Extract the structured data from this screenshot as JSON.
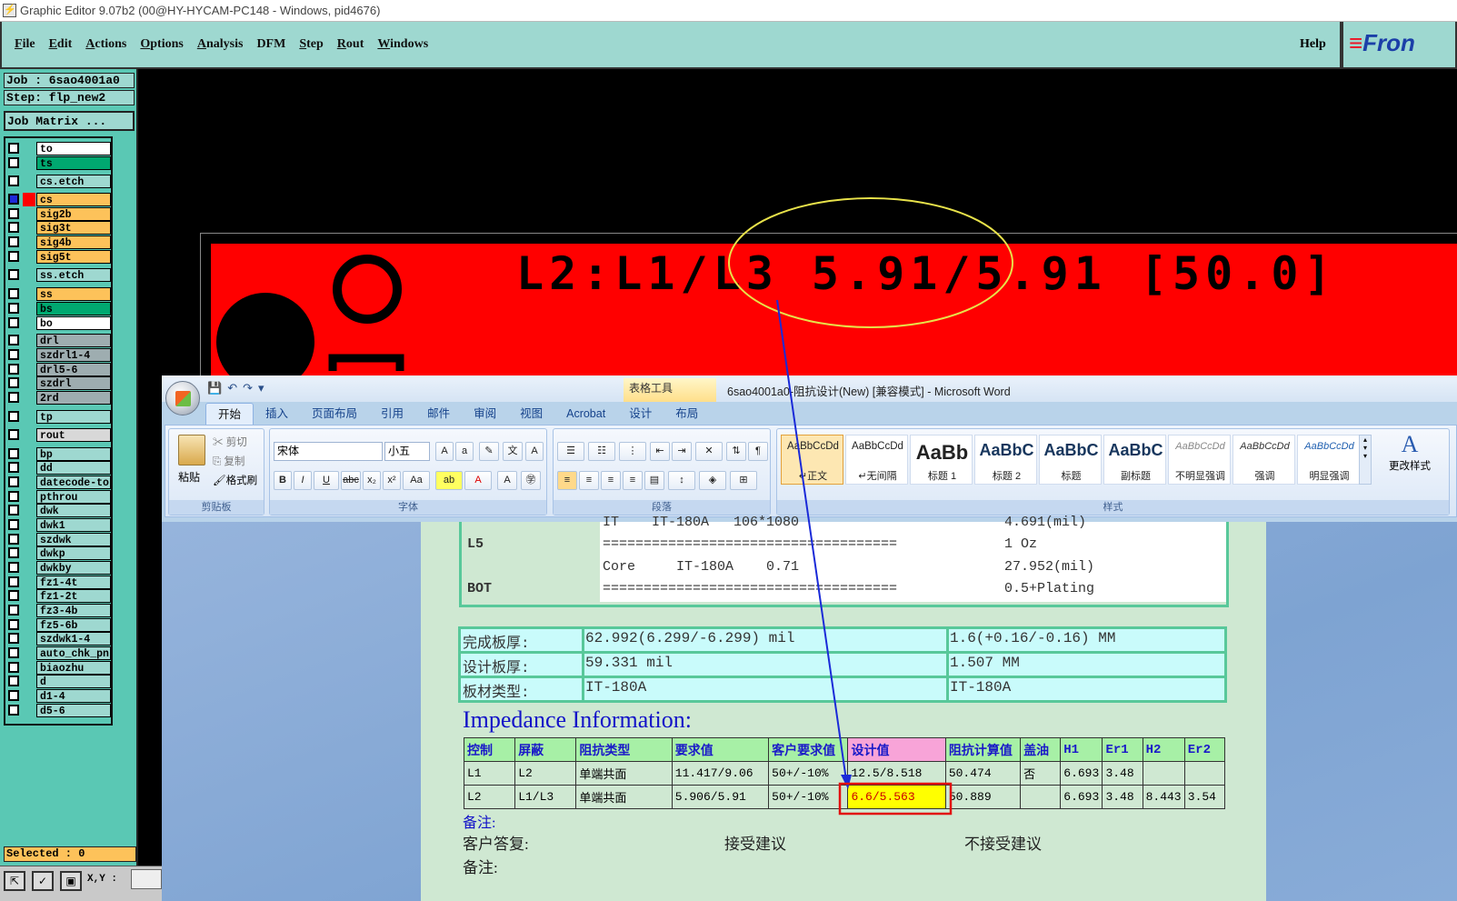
{
  "ge": {
    "title": "Graphic Editor 9.07b2 (00@HY-HYCAM-PC148 - Windows, pid4676)",
    "menu": [
      "File",
      "Edit",
      "Actions",
      "Options",
      "Analysis",
      "DFM",
      "Step",
      "Rout",
      "Windows"
    ],
    "help": "Help",
    "logo": "Fron",
    "job_label": "Job : 6sao4001a0",
    "step_label": "Step: flp_new2",
    "job_matrix": "Job Matrix ...",
    "selected": "Selected : 0",
    "coord_label": "X,Y :",
    "layers": [
      {
        "name": "to",
        "color": "#ffffff"
      },
      {
        "name": "ts",
        "color": "#00a870"
      },
      {
        "name": "cs.etch",
        "color": "#9ed8d0"
      },
      {
        "name": "cs",
        "color": "#fdc25a",
        "active": true
      },
      {
        "name": "sig2b",
        "color": "#fdc25a"
      },
      {
        "name": "sig3t",
        "color": "#fdc25a"
      },
      {
        "name": "sig4b",
        "color": "#fdc25a"
      },
      {
        "name": "sig5t",
        "color": "#fdc25a"
      },
      {
        "name": "ss.etch",
        "color": "#9ed8d0"
      },
      {
        "name": "ss",
        "color": "#fdc25a"
      },
      {
        "name": "bs",
        "color": "#00a870"
      },
      {
        "name": "bo",
        "color": "#ffffff"
      },
      {
        "name": "drl",
        "color": "#9eadb0"
      },
      {
        "name": "szdrl1-4",
        "color": "#9eadb0"
      },
      {
        "name": "drl5-6",
        "color": "#9eadb0"
      },
      {
        "name": "szdrl",
        "color": "#9eadb0"
      },
      {
        "name": "2rd",
        "color": "#9eadb0"
      },
      {
        "name": "tp",
        "color": "#9ed8d0"
      },
      {
        "name": "rout",
        "color": "#d8d8d8"
      },
      {
        "name": "bp",
        "color": "#9ed8d0"
      },
      {
        "name": "dd",
        "color": "#9ed8d0"
      },
      {
        "name": "datecode-to",
        "color": "#9ed8d0"
      },
      {
        "name": "pthrou",
        "color": "#9ed8d0"
      },
      {
        "name": "dwk",
        "color": "#9ed8d0"
      },
      {
        "name": "dwk1",
        "color": "#9ed8d0"
      },
      {
        "name": "szdwk",
        "color": "#9ed8d0"
      },
      {
        "name": "dwkp",
        "color": "#9ed8d0"
      },
      {
        "name": "dwkby",
        "color": "#9ed8d0"
      },
      {
        "name": "fz1-4t",
        "color": "#9ed8d0"
      },
      {
        "name": "fz1-2t",
        "color": "#9ed8d0"
      },
      {
        "name": "fz3-4b",
        "color": "#9ed8d0"
      },
      {
        "name": "fz5-6b",
        "color": "#9ed8d0"
      },
      {
        "name": "szdwk1-4",
        "color": "#9ed8d0"
      },
      {
        "name": "auto_chk_pn",
        "color": "#9ed8d0"
      },
      {
        "name": "biaozhu",
        "color": "#9ed8d0"
      },
      {
        "name": "d",
        "color": "#9ed8d0"
      },
      {
        "name": "d1-4",
        "color": "#9ed8d0"
      },
      {
        "name": "d5-6",
        "color": "#9ed8d0"
      }
    ],
    "board_text": "L2:L1/L3 5.91/5.91 [50.0]",
    "colors": {
      "board": "#ff0000",
      "menubar": "#9ed8d0",
      "panel": "#5ac8b4",
      "highlight_ellipse": "#e8e24a",
      "arrow": "#1a2ad8"
    }
  },
  "word": {
    "title": "6sao4001a0-阻抗设计(New) [兼容模式] - Microsoft Word",
    "table_tools": "表格工具",
    "tabs": [
      "开始",
      "插入",
      "页面布局",
      "引用",
      "邮件",
      "审阅",
      "视图",
      "Acrobat",
      "设计",
      "布局"
    ],
    "clipboard": {
      "paste": "粘贴",
      "cut": "剪切",
      "copy": "复制",
      "format_painter": "格式刷",
      "label": "剪贴板"
    },
    "font": {
      "name": "宋体",
      "size": "小五",
      "label": "字体"
    },
    "paragraph_label": "段落",
    "styles_label": "样式",
    "change_styles": "更改样式",
    "styles": [
      {
        "preview": "AaBbCcDd",
        "label": "↵正文",
        "active": true
      },
      {
        "preview": "AaBbCcDd",
        "label": "↵无间隔"
      },
      {
        "preview": "AaBb",
        "label": "标题 1"
      },
      {
        "preview": "AaBbC",
        "label": "标题 2"
      },
      {
        "preview": "AaBbC",
        "label": "标题"
      },
      {
        "preview": "AaBbC",
        "label": "副标题"
      },
      {
        "preview": "AaBbCcDd",
        "label": "不明显强调"
      },
      {
        "preview": "AaBbCcDd",
        "label": "强调"
      },
      {
        "preview": "AaBbCcDd",
        "label": "明显强调"
      }
    ]
  },
  "doc": {
    "stack_rows": [
      {
        "left": "",
        "mid": "IT    IT-180A   106*1080",
        "right": "4.691(mil)"
      },
      {
        "left": "L5",
        "mid": "====================================",
        "right": "1 Oz"
      },
      {
        "left": "",
        "mid": "Core     IT-180A    0.71",
        "right": "27.952(mil)"
      },
      {
        "left": "BOT",
        "mid": "====================================",
        "right": "0.5+Plating"
      }
    ],
    "thickness": [
      {
        "label": "完成板厚:",
        "mil": "62.992(6.299/-6.299) mil",
        "mm": "1.6(+0.16/-0.16) MM"
      },
      {
        "label": "设计板厚:",
        "mil": "59.331 mil",
        "mm": "1.507 MM"
      },
      {
        "label": "板材类型:",
        "mil": "IT-180A",
        "mm": "IT-180A"
      }
    ],
    "impedance_title": "Impedance Information:",
    "imp_headers": [
      "控制",
      "屏蔽",
      "阻抗类型",
      "要求值",
      "客户要求值",
      "设计值",
      "阻抗计算值",
      "盖油",
      "H1",
      "Er1",
      "H2",
      "Er2"
    ],
    "imp_rows": [
      [
        "L1",
        "L2",
        "单端共面",
        "11.417/9.06",
        "50+/-10%",
        "12.5/8.518",
        "50.474",
        "否",
        "6.693",
        "3.48",
        "",
        ""
      ],
      [
        "L2",
        "L1/L3",
        "单端共面",
        "5.906/5.91",
        "50+/-10%",
        "6.6/5.563",
        "50.889",
        "",
        "6.693",
        "3.48",
        "8.443",
        "3.54"
      ]
    ],
    "note1": "备注:",
    "reply_label": "客户答复:",
    "accept": "接受建议",
    "reject": "不接受建议",
    "note2": "备注:"
  }
}
